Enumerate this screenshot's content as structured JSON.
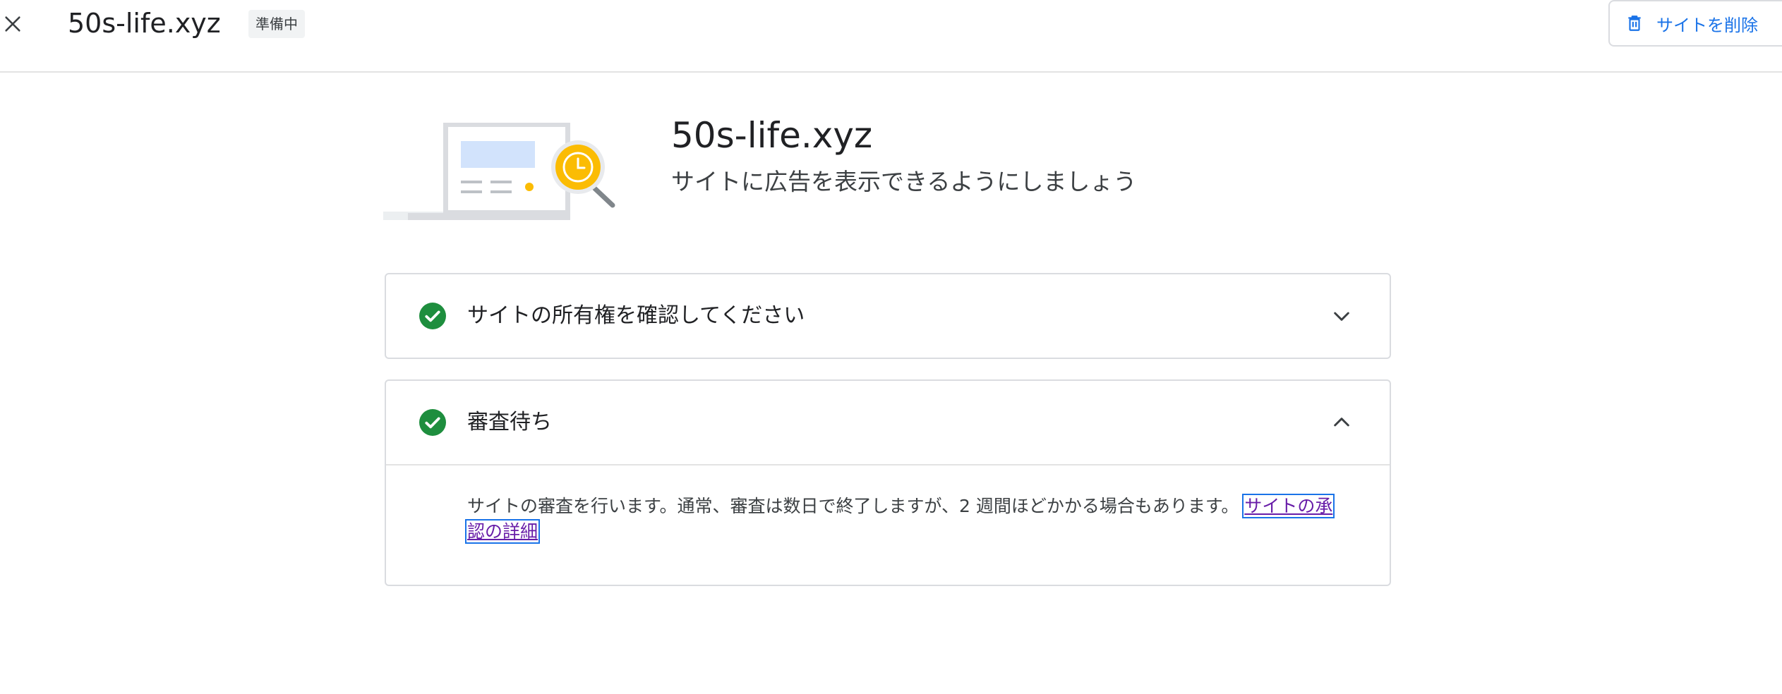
{
  "header": {
    "close_icon": "close-icon",
    "site_name": "50s-life.xyz",
    "status_badge": "準備中",
    "delete_button": {
      "icon": "trash-icon",
      "label": "サイトを削除"
    }
  },
  "hero": {
    "illustration": "site-review-illustration",
    "title": "50s-life.xyz",
    "subtitle": "サイトに広告を表示できるようにしましょう"
  },
  "steps": [
    {
      "label": "サイトの所有権を確認してください",
      "status_icon": "check-circle-icon",
      "expanded": false,
      "chevron_icon": "chevron-down-icon"
    },
    {
      "label": "審査待ち",
      "status_icon": "check-circle-icon",
      "expanded": true,
      "chevron_icon": "chevron-up-icon",
      "body_text": "サイトの審査を行います。通常、審査は数日で終了しますが、2 週間ほどかかる場合もあります。",
      "link_text": "サイトの承認の詳細"
    }
  ],
  "colors": {
    "accent_blue": "#1a73e8",
    "success_green": "#1e8e3e",
    "link_visited": "#681da8",
    "border": "#dadce0",
    "illustration_yellow": "#fbbc04"
  }
}
